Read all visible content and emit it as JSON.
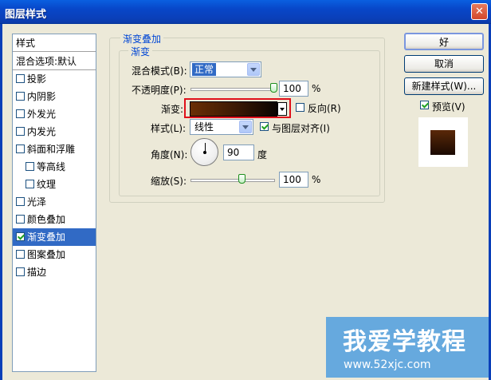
{
  "window": {
    "title": "图层样式",
    "close_glyph": "✕"
  },
  "sidebar": {
    "header": "样式",
    "blend_options": "混合选项:默认",
    "items": [
      {
        "label": "投影",
        "checked": false,
        "indent": false
      },
      {
        "label": "内阴影",
        "checked": false,
        "indent": false
      },
      {
        "label": "外发光",
        "checked": false,
        "indent": false
      },
      {
        "label": "内发光",
        "checked": false,
        "indent": false
      },
      {
        "label": "斜面和浮雕",
        "checked": false,
        "indent": false
      },
      {
        "label": "等高线",
        "checked": false,
        "indent": true
      },
      {
        "label": "纹理",
        "checked": false,
        "indent": true
      },
      {
        "label": "光泽",
        "checked": false,
        "indent": false
      },
      {
        "label": "颜色叠加",
        "checked": false,
        "indent": false
      },
      {
        "label": "渐变叠加",
        "checked": true,
        "indent": false,
        "selected": true
      },
      {
        "label": "图案叠加",
        "checked": false,
        "indent": false
      },
      {
        "label": "描边",
        "checked": false,
        "indent": false
      }
    ]
  },
  "panel": {
    "group_title": "渐变叠加",
    "subgroup_title": "渐变",
    "blend_mode_label": "混合模式(B):",
    "blend_mode_value": "正常",
    "opacity_label": "不透明度(P):",
    "opacity_value": "100",
    "opacity_unit": "%",
    "opacity_level": 1.0,
    "gradient_label": "渐变:",
    "reverse_label": "反向(R)",
    "reverse_checked": false,
    "style_label": "样式(L):",
    "style_value": "线性",
    "align_label": "与图层对齐(I)",
    "align_checked": true,
    "angle_label": "角度(N):",
    "angle_value": "90",
    "angle_unit": "度",
    "scale_label": "缩放(S):",
    "scale_value": "100",
    "scale_unit": "%",
    "gradient_colors": [
      "#6a2e05",
      "#3e1a04",
      "#0a0402"
    ]
  },
  "buttons": {
    "ok": "好",
    "cancel": "取消",
    "new_style": "新建样式(W)...",
    "preview_label": "预览(V)",
    "preview_checked": true
  },
  "watermark": {
    "title": "我爱学教程",
    "url": "www.52xjc.com"
  }
}
